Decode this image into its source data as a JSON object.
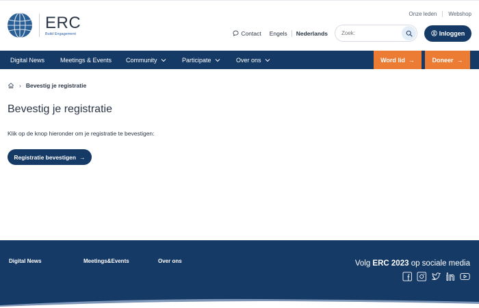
{
  "header": {
    "logo_title": "ERC",
    "logo_subtitle": "Build Engagement",
    "top_links": [
      "Onze leden",
      "Webshop"
    ],
    "contact_label": "Contact",
    "languages": [
      "Engels",
      "Nederlands"
    ],
    "active_language": "Nederlands",
    "search_placeholder": "Zoek:",
    "login_label": "Inloggen"
  },
  "nav": {
    "items": [
      {
        "label": "Digital News",
        "has_dropdown": false
      },
      {
        "label": "Meetings & Events",
        "has_dropdown": false
      },
      {
        "label": "Community",
        "has_dropdown": true
      },
      {
        "label": "Participate",
        "has_dropdown": true
      },
      {
        "label": "Over ons",
        "has_dropdown": true
      }
    ],
    "cta_member": "Word lid",
    "cta_donate": "Doneer"
  },
  "breadcrumb": {
    "current": "Bevestig je registratie"
  },
  "main": {
    "title": "Bevestig je registratie",
    "intro": "Klik op de knop hieronder om je registratie te bevestigen:",
    "confirm_button": "Registratie bevestigen"
  },
  "footer": {
    "links": [
      "Digital News",
      "Meetings&Events",
      "Over ons"
    ],
    "social_prefix": "Volg",
    "social_brand": "ERC 2023",
    "social_suffix": "op sociale media",
    "social_icons": [
      "facebook-icon",
      "instagram-icon",
      "twitter-icon",
      "linkedin-icon",
      "youtube-icon"
    ]
  },
  "colors": {
    "navy": "#163a66",
    "orange": "#ec7b33",
    "text": "#2a3646"
  }
}
